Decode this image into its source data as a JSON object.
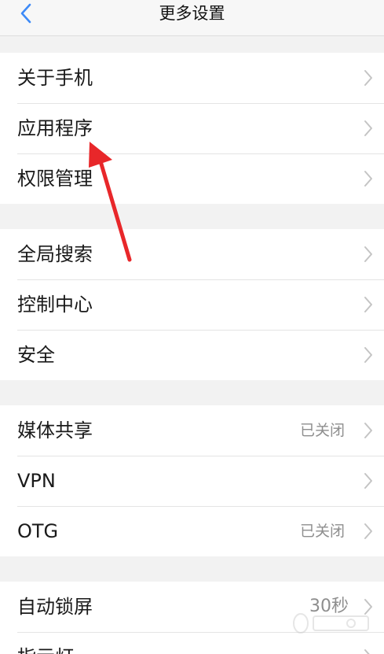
{
  "navbar": {
    "title": "更多设置"
  },
  "groups": [
    {
      "items": [
        {
          "label": "关于手机",
          "value": ""
        },
        {
          "label": "应用程序",
          "value": ""
        },
        {
          "label": "权限管理",
          "value": ""
        }
      ]
    },
    {
      "items": [
        {
          "label": "全局搜索",
          "value": ""
        },
        {
          "label": "控制中心",
          "value": ""
        },
        {
          "label": "安全",
          "value": ""
        }
      ]
    },
    {
      "items": [
        {
          "label": "媒体共享",
          "value": "已关闭"
        },
        {
          "label": "VPN",
          "value": ""
        },
        {
          "label": "OTG",
          "value": "已关闭"
        }
      ]
    },
    {
      "items": [
        {
          "label": "自动锁屏",
          "value": "30秒"
        },
        {
          "label": "指示灯",
          "value": ""
        }
      ]
    }
  ],
  "colors": {
    "accent": "#3d8af7",
    "background": "#f2f2f2",
    "annotation_arrow": "#e8272a"
  },
  "icons": {
    "back": "chevron-left-icon",
    "row": "chevron-right-icon"
  }
}
